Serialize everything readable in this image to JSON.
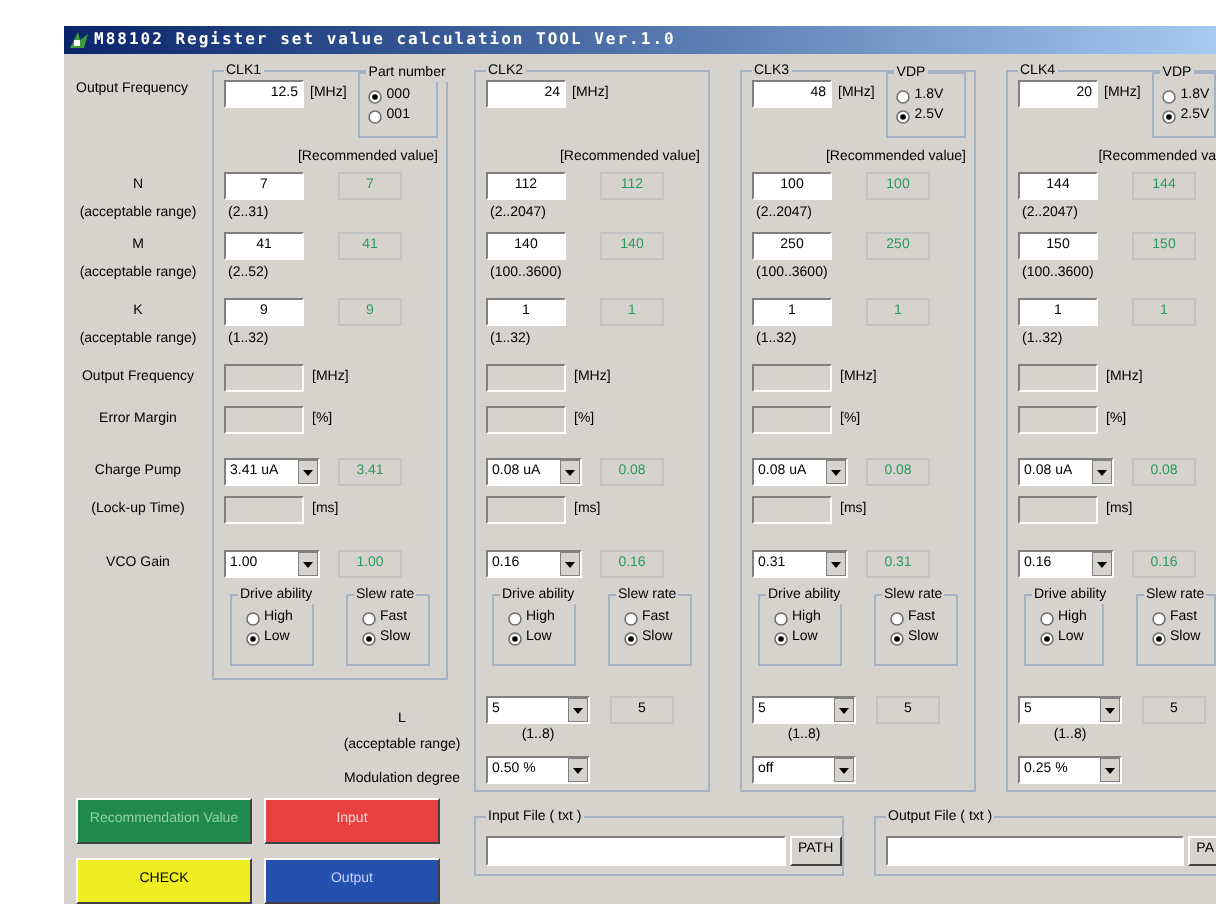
{
  "window": {
    "title": "M88102 Register set value calculation TOOL Ver.1.0"
  },
  "row_labels": {
    "output_frequency": "Output Frequency",
    "n": "N",
    "n_range": "(acceptable range)",
    "m": "M",
    "m_range": "(acceptable range)",
    "k": "K",
    "k_range": "(acceptable range)",
    "result_frequency": "Output Frequency",
    "error_margin": "Error Margin",
    "charge_pump": "Charge Pump",
    "lockup_time": "(Lock-up Time)",
    "vco_gain": "VCO Gain"
  },
  "l_labels": {
    "l": "L",
    "range": "(acceptable range)",
    "modulation": "Modulation degree"
  },
  "clocks": [
    {
      "title": "CLK1",
      "frequency": "12.5",
      "unit": "[MHz]",
      "option_group": {
        "title": "Part number",
        "options": [
          {
            "label": "000",
            "selected": true
          },
          {
            "label": "001",
            "selected": false
          }
        ]
      },
      "recommended_label": "[Recommended value]",
      "n": {
        "value": "7",
        "recommended": "7",
        "range": "(2..31)"
      },
      "m": {
        "value": "41",
        "recommended": "41",
        "range": "(2..52)"
      },
      "k": {
        "value": "9",
        "recommended": "9",
        "range": "(1..32)"
      },
      "frequency_unit": "[MHz]",
      "error_unit": "[%]",
      "charge_pump": {
        "value": "3.41 uA",
        "recommended": "3.41"
      },
      "lockup_unit": "[ms]",
      "vco_gain": {
        "value": "1.00",
        "recommended": "1.00"
      },
      "drive_ability": {
        "title": "Drive ability",
        "options": [
          {
            "label": "High",
            "selected": false
          },
          {
            "label": "Low",
            "selected": true
          }
        ]
      },
      "slew_rate": {
        "title": "Slew rate",
        "options": [
          {
            "label": "Fast",
            "selected": false
          },
          {
            "label": "Slow",
            "selected": true
          }
        ]
      }
    },
    {
      "title": "CLK2",
      "frequency": "24",
      "unit": "[MHz]",
      "recommended_label": "[Recommended value]",
      "n": {
        "value": "112",
        "recommended": "112",
        "range": "(2..2047)"
      },
      "m": {
        "value": "140",
        "recommended": "140",
        "range": "(100..3600)"
      },
      "k": {
        "value": "1",
        "recommended": "1",
        "range": "(1..32)"
      },
      "frequency_unit": "[MHz]",
      "error_unit": "[%]",
      "charge_pump": {
        "value": "0.08 uA",
        "recommended": "0.08"
      },
      "lockup_unit": "[ms]",
      "vco_gain": {
        "value": "0.16",
        "recommended": "0.16"
      },
      "drive_ability": {
        "title": "Drive ability",
        "options": [
          {
            "label": "High",
            "selected": false
          },
          {
            "label": "Low",
            "selected": true
          }
        ]
      },
      "slew_rate": {
        "title": "Slew rate",
        "options": [
          {
            "label": "Fast",
            "selected": false
          },
          {
            "label": "Slow",
            "selected": true
          }
        ]
      },
      "l": {
        "value": "5",
        "recommended": "5",
        "range": "(1..8)"
      },
      "modulation": "0.50 %"
    },
    {
      "title": "CLK3",
      "frequency": "48",
      "unit": "[MHz]",
      "option_group": {
        "title": "VDP",
        "options": [
          {
            "label": "1.8V",
            "selected": false
          },
          {
            "label": "2.5V",
            "selected": true
          }
        ]
      },
      "recommended_label": "[Recommended value]",
      "n": {
        "value": "100",
        "recommended": "100",
        "range": "(2..2047)"
      },
      "m": {
        "value": "250",
        "recommended": "250",
        "range": "(100..3600)"
      },
      "k": {
        "value": "1",
        "recommended": "1",
        "range": "(1..32)"
      },
      "frequency_unit": "[MHz]",
      "error_unit": "[%]",
      "charge_pump": {
        "value": "0.08 uA",
        "recommended": "0.08"
      },
      "lockup_unit": "[ms]",
      "vco_gain": {
        "value": "0.31",
        "recommended": "0.31"
      },
      "drive_ability": {
        "title": "Drive ability",
        "options": [
          {
            "label": "High",
            "selected": false
          },
          {
            "label": "Low",
            "selected": true
          }
        ]
      },
      "slew_rate": {
        "title": "Slew rate",
        "options": [
          {
            "label": "Fast",
            "selected": false
          },
          {
            "label": "Slow",
            "selected": true
          }
        ]
      },
      "l": {
        "value": "5",
        "recommended": "5",
        "range": "(1..8)"
      },
      "modulation": "off"
    },
    {
      "title": "CLK4",
      "frequency": "20",
      "unit": "[MHz]",
      "option_group": {
        "title": "VDP",
        "options": [
          {
            "label": "1.8V",
            "selected": false
          },
          {
            "label": "2.5V",
            "selected": true
          }
        ]
      },
      "recommended_label": "[Recommended va",
      "n": {
        "value": "144",
        "recommended": "144",
        "range": "(2..2047)"
      },
      "m": {
        "value": "150",
        "recommended": "150",
        "range": "(100..3600)"
      },
      "k": {
        "value": "1",
        "recommended": "1",
        "range": "(1..32)"
      },
      "frequency_unit": "[MHz]",
      "error_unit": "[%]",
      "charge_pump": {
        "value": "0.08 uA",
        "recommended": "0.08"
      },
      "lockup_unit": "[ms]",
      "vco_gain": {
        "value": "0.16",
        "recommended": "0.16"
      },
      "drive_ability": {
        "title": "Drive ability",
        "options": [
          {
            "label": "High",
            "selected": false
          },
          {
            "label": "Low",
            "selected": true
          }
        ]
      },
      "slew_rate": {
        "title": "Slew rate",
        "options": [
          {
            "label": "Fast",
            "selected": false
          },
          {
            "label": "Slow",
            "selected": true
          }
        ]
      },
      "l": {
        "value": "5",
        "recommended": "5",
        "range": "(1..8)"
      },
      "modulation": "0.25 %"
    }
  ],
  "buttons": [
    {
      "label": "Recommendation Value",
      "kind": "recommend"
    },
    {
      "label": "Input",
      "kind": "input"
    },
    {
      "label": "CHECK",
      "kind": "check"
    },
    {
      "label": "Output",
      "kind": "output"
    }
  ],
  "files": [
    {
      "title": "Input File ( txt )",
      "button": "PATH"
    },
    {
      "title": "Output File ( txt )",
      "button": "PA"
    }
  ]
}
